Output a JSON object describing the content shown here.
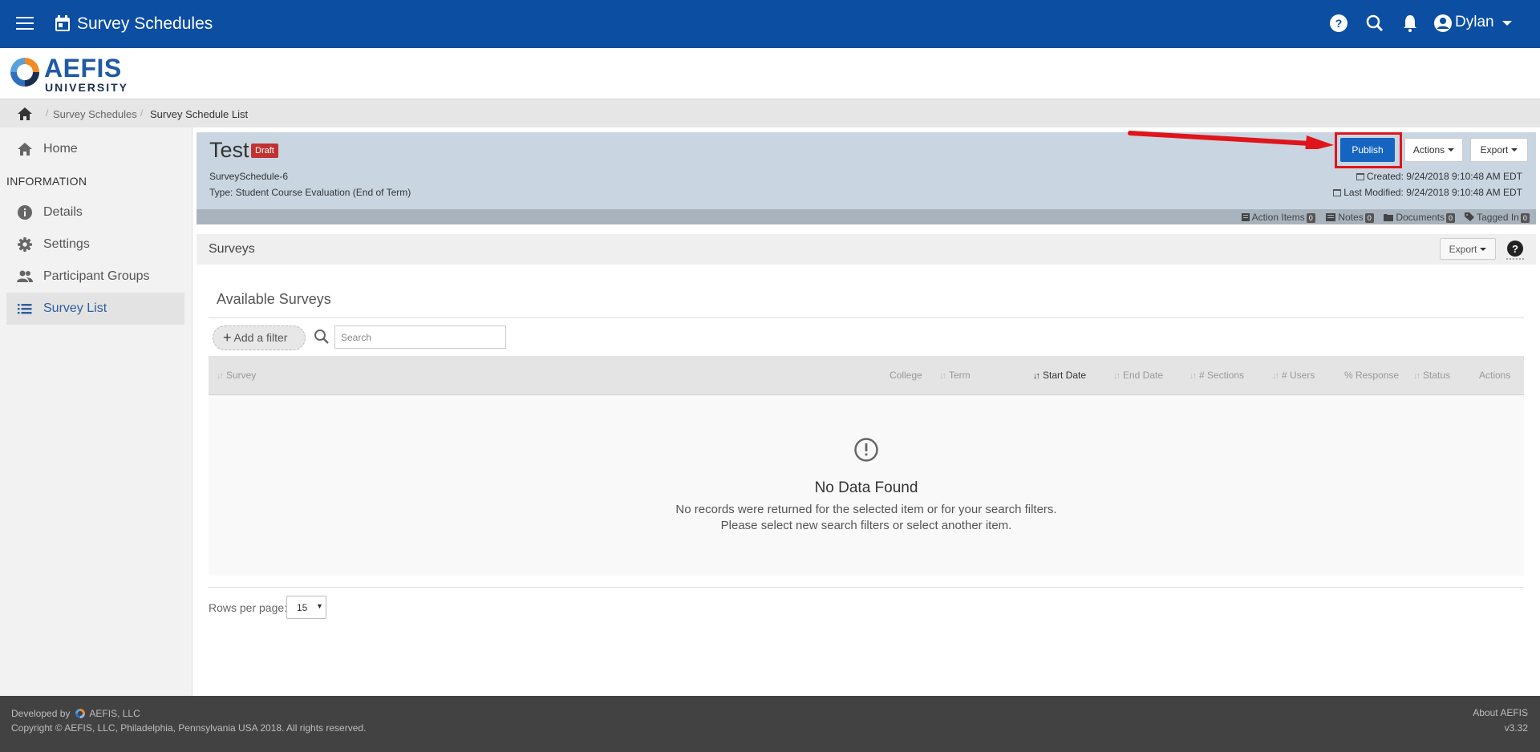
{
  "header": {
    "app_title": "Survey Schedules",
    "user_name": "Dylan"
  },
  "logo": {
    "name": "AEFIS",
    "sub": "UNIVERSITY"
  },
  "breadcrumb": {
    "items": [
      "Survey Schedules",
      "Survey Schedule List"
    ]
  },
  "sidebar": {
    "home_label": "Home",
    "section_heading": "INFORMATION",
    "items": [
      {
        "label": "Details",
        "icon": "info-icon"
      },
      {
        "label": "Settings",
        "icon": "gear-icon"
      },
      {
        "label": "Participant Groups",
        "icon": "people-icon"
      },
      {
        "label": "Survey List",
        "icon": "list-icon",
        "active": true
      }
    ]
  },
  "record": {
    "title": "Test",
    "status_badge": "Draft",
    "id": "SurveySchedule-6",
    "type": "Type: Student Course Evaluation (End of Term)",
    "created": "Created: 9/24/2018 9:10:48 AM EDT",
    "modified": "Last Modified: 9/24/2018 9:10:48 AM EDT",
    "publish_label": "Publish",
    "actions_label": "Actions",
    "export_label": "Export",
    "strip": [
      {
        "label": "Action Items",
        "count": "0"
      },
      {
        "label": "Notes",
        "count": "0"
      },
      {
        "label": "Documents",
        "count": "0"
      },
      {
        "label": "Tagged In",
        "count": "0"
      }
    ]
  },
  "surveys": {
    "panel_title": "Surveys",
    "export_label": "Export",
    "section_title": "Available Surveys",
    "add_filter_label": "Add a filter",
    "search_placeholder": "Search",
    "columns": [
      "Survey",
      "College",
      "Term",
      "Start Date",
      "End Date",
      "# Sections",
      "# Users",
      "% Response",
      "Status",
      "Actions"
    ],
    "sorted_column": "Start Date",
    "empty_title": "No Data Found",
    "empty_line1": "No records were returned for the selected item or for your search filters.",
    "empty_line2": "Please select new search filters or select another item.",
    "rows_per_page_label": "Rows per page:",
    "rows_per_page_value": "15"
  },
  "footer": {
    "developed_prefix": "Developed by",
    "developed_company": "AEFIS, LLC",
    "copyright": "Copyright © AEFIS, LLC, Philadelphia, Pennsylvania USA 2018. All rights reserved.",
    "about": "About AEFIS",
    "version": "v3.32"
  },
  "colors": {
    "topbar": "#0b4ea2",
    "publish": "#1565c0",
    "highlight": "#e0151c",
    "draft": "#c13232"
  }
}
